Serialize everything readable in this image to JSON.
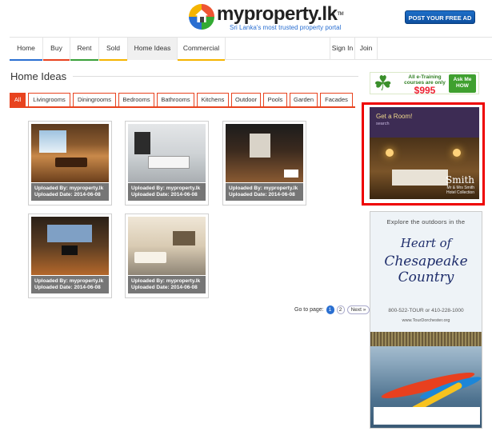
{
  "header": {
    "logo_text": "myproperty.lk",
    "logo_tm": "TM",
    "tagline": "Sri Lanka's most trusted property portal",
    "post_button": "POST YOUR FREE AD"
  },
  "nav": {
    "items": [
      {
        "label": "Home",
        "bar_color": "#2a6fd1"
      },
      {
        "label": "Buy",
        "bar_color": "#e8431f"
      },
      {
        "label": "Rent",
        "bar_color": "#3aa03a"
      },
      {
        "label": "Sold",
        "bar_color": "#f5b400"
      },
      {
        "label": "Home Ideas",
        "bar_color": "#f0f0f0"
      },
      {
        "label": "Commercial",
        "bar_color": "#f5b400"
      }
    ],
    "sign_in": "Sign In",
    "join": "Join"
  },
  "page_title": "Home Ideas",
  "tabs": [
    "All",
    "Livingrooms",
    "Diningrooms",
    "Bedrooms",
    "Bathrooms",
    "Kitchens",
    "Outdoor",
    "Pools",
    "Garden",
    "Facades"
  ],
  "cards": [
    {
      "uploaded_by": "Uploaded By: myproperty.lk",
      "uploaded_date": "Uploaded Date: 2014-06-08"
    },
    {
      "uploaded_by": "Uploaded By: myproperty.lk",
      "uploaded_date": "Uploaded Date: 2014-06-08"
    },
    {
      "uploaded_by": "Uploaded By: myproperty.lk",
      "uploaded_date": "Uploaded Date: 2014-06-08"
    },
    {
      "uploaded_by": "Uploaded By: myproperty.lk",
      "uploaded_date": "Uploaded Date: 2014-06-08"
    },
    {
      "uploaded_by": "Uploaded By: myproperty.lk",
      "uploaded_date": "Uploaded Date: 2014-06-08"
    }
  ],
  "pagination": {
    "label": "Go to page:",
    "pages": [
      "1",
      "2"
    ],
    "next": "Next »"
  },
  "ads": {
    "training": {
      "line1": "All e-Training",
      "line2": "courses are only",
      "price": "$995",
      "cta": "Ask Me HOW"
    },
    "hotel": {
      "headline": "Get a Room!",
      "sub": "search",
      "brand_name": "Smith",
      "brand_line1": "Mr & Mrs Smith",
      "brand_line2": "Hotel Collection"
    },
    "tourism": {
      "top": "Explore the outdoors in the",
      "heading1": "Heart of",
      "heading2": "Chesapeake",
      "heading3": "Country",
      "phone": "800-522-TOUR or 410-228-1000",
      "url": "www.TourDorchester.org"
    }
  },
  "colors": {
    "accent": "#e8431f",
    "brand_blue": "#2a6fd1",
    "highlight": "#ee0000"
  }
}
